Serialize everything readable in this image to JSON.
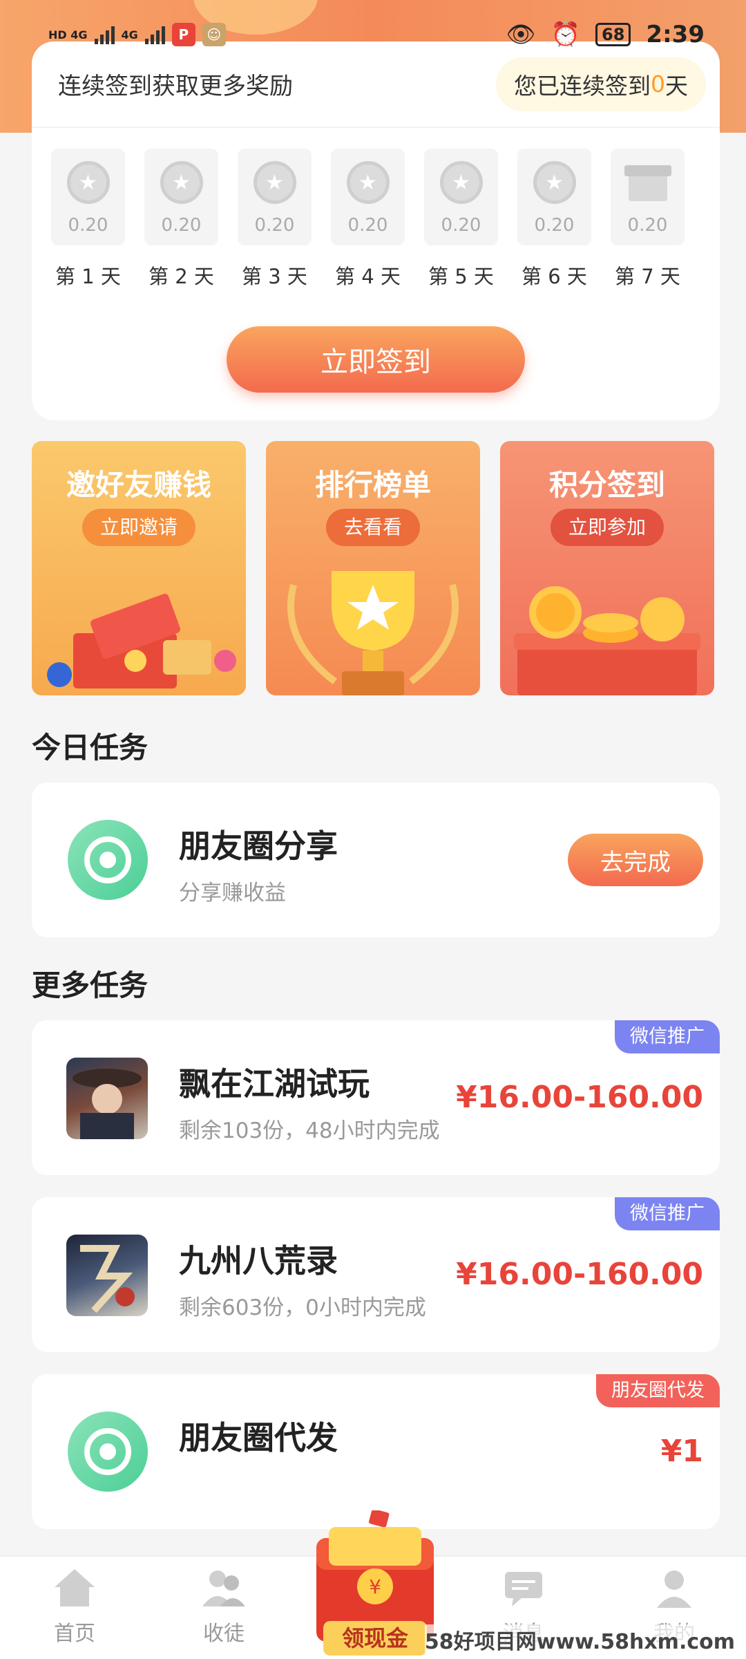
{
  "status_bar": {
    "left_indicators": [
      "HD 4G",
      "4G"
    ],
    "battery": "68",
    "time": "2:39"
  },
  "checkin": {
    "title": "连续签到获取更多奖励",
    "streak_prefix": "您已连续签到",
    "streak_days": "0",
    "streak_suffix": "天",
    "days": [
      {
        "amount": "0.20",
        "label": "第 1 天"
      },
      {
        "amount": "0.20",
        "label": "第 2 天"
      },
      {
        "amount": "0.20",
        "label": "第 3 天"
      },
      {
        "amount": "0.20",
        "label": "第 4 天"
      },
      {
        "amount": "0.20",
        "label": "第 5 天"
      },
      {
        "amount": "0.20",
        "label": "第 6 天"
      },
      {
        "amount": "0.20",
        "label": "第 7 天"
      }
    ],
    "button": "立即签到"
  },
  "promos": [
    {
      "title": "邀好友赚钱",
      "button": "立即邀请"
    },
    {
      "title": "排行榜单",
      "button": "去看看"
    },
    {
      "title": "积分签到",
      "button": "立即参加"
    }
  ],
  "today_tasks": {
    "title": "今日任务",
    "items": [
      {
        "name": "朋友圈分享",
        "subtitle": "分享赚收益",
        "button": "去完成"
      }
    ]
  },
  "more_tasks": {
    "title": "更多任务",
    "items": [
      {
        "name": "飘在江湖试玩",
        "subtitle": "剩余103份，48小时内完成",
        "price": "¥16.00-160.00",
        "tag": "微信推广"
      },
      {
        "name": "九州八荒录",
        "subtitle": "剩余603份，0小时内完成",
        "price": "¥16.00-160.00",
        "tag": "微信推广"
      },
      {
        "name": "朋友圈代发",
        "subtitle": "",
        "price": "¥1",
        "tag": "朋友圈代发"
      }
    ]
  },
  "bottom_nav": {
    "items": [
      {
        "label": "首页",
        "icon": "home-icon"
      },
      {
        "label": "收徒",
        "icon": "users-icon"
      },
      {
        "label": "领现金",
        "icon": "red-envelope-icon"
      },
      {
        "label": "消息",
        "icon": "message-icon"
      },
      {
        "label": "我的",
        "icon": "profile-icon"
      }
    ]
  },
  "watermark": "58好项目网www.58hxm.com",
  "colors": {
    "accent_orange": "#f36a4e",
    "price_red": "#e8443a",
    "tag_blue": "#7c84f2",
    "tag_red": "#f2625a",
    "wechat_green": "#4ccf97"
  }
}
